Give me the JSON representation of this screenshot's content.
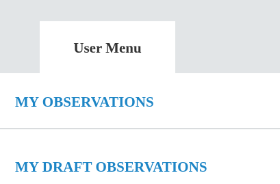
{
  "tabs": {
    "active_label": "User Menu"
  },
  "menu": {
    "items": [
      {
        "label": "MY OBSERVATIONS"
      },
      {
        "label": "MY DRAFT OBSERVATIONS"
      }
    ]
  },
  "colors": {
    "tab_bar_background": "#e2e5e7",
    "active_tab_background": "#ffffff",
    "link_color": "#1e86c6",
    "tab_text_color": "#333333",
    "divider_color": "#d9dcde"
  }
}
